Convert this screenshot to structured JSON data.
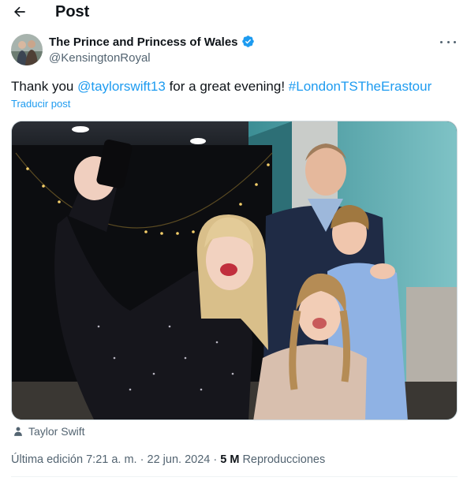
{
  "header": {
    "title": "Post",
    "back_icon": "arrow-left-icon"
  },
  "author": {
    "display_name": "The Prince and Princess of Wales",
    "handle": "@KensingtonRoyal",
    "verified": true,
    "verified_color": "#1d9bf0"
  },
  "tweet": {
    "text_prefix": "Thank you ",
    "mention": "@taylorswift13",
    "text_middle": " for a great evening! ",
    "hashtag": "#LondonTSTheErastour",
    "translate_label": "Traducir post"
  },
  "tagged_user": {
    "name": "Taylor Swift",
    "icon": "person-icon"
  },
  "meta": {
    "edited_label": "Última edición",
    "time": "7:21 a. m.",
    "separator": "·",
    "date": "22 jun. 2024",
    "views_count": "5 M",
    "views_label": "Reproducciones"
  },
  "colors": {
    "accent": "#1d9bf0",
    "secondary_text": "#536471",
    "primary_text": "#0f1419"
  }
}
